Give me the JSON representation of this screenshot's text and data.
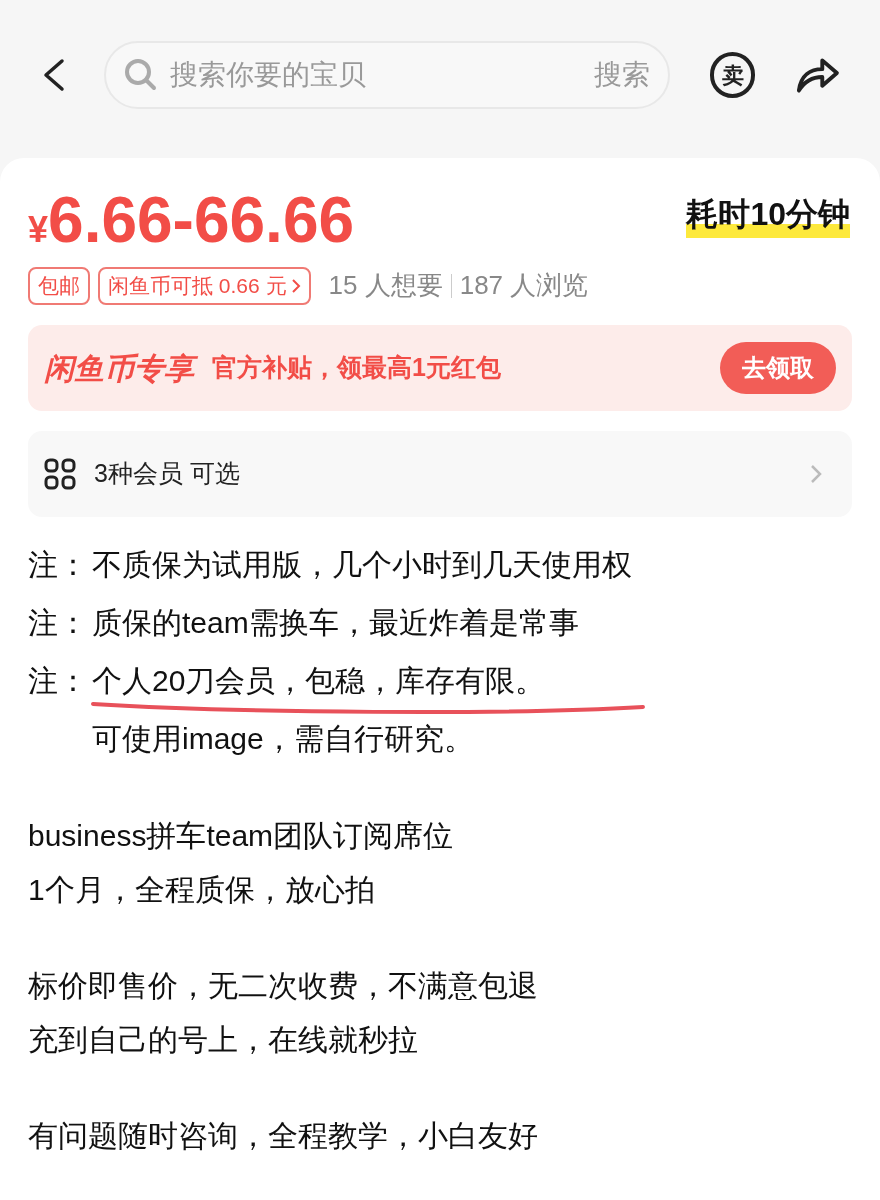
{
  "search": {
    "placeholder": "搜索你要的宝贝",
    "button": "搜索"
  },
  "header_icon_text": "卖",
  "price": {
    "currency": "¥",
    "value": "6.66-66.66"
  },
  "highlight": "耗时10分钟",
  "tags": [
    {
      "label": "包邮",
      "has_arrow": false
    },
    {
      "label": "闲鱼币可抵 0.66 元",
      "has_arrow": true
    }
  ],
  "stats": [
    "15 人想要",
    "187 人浏览"
  ],
  "promo": {
    "title": "闲鱼币专享",
    "text": "官方补贴，领最高1元红包",
    "button": "去领取"
  },
  "options": {
    "text": "3种会员 可选"
  },
  "notes": [
    {
      "prefix": "注：",
      "text": "不质保为试用版，几个小时到几天使用权",
      "underlined": false
    },
    {
      "prefix": "注：",
      "text": "质保的team需换车，最近炸着是常事",
      "underlined": false
    },
    {
      "prefix": "注：",
      "text": "个人20刀会员，包稳，库存有限。",
      "underlined": true
    },
    {
      "text": "可使用image，需自行研究。",
      "underlined": false
    }
  ],
  "paragraphs": [
    [
      "business拼车team团队订阅席位",
      "1个月，全程质保，放心拍"
    ],
    [
      "标价即售价，无二次收费，不满意包退",
      "充到自己的号上，在线就秒拉"
    ],
    [
      "有问题随时咨询，全程教学，小白友好"
    ]
  ]
}
